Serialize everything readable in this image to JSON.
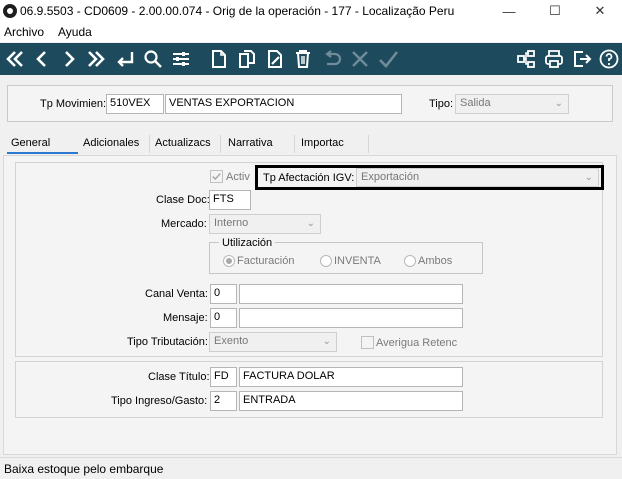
{
  "window": {
    "title": "06.9.5503 - CD0609 - 2.00.00.074 - Orig de la operación - 177 - Localização Peru",
    "minimize": "—",
    "maximize": "☐",
    "close": "✕"
  },
  "menu": {
    "items": [
      "Archivo",
      "Ayuda"
    ]
  },
  "toolbar": {
    "left_icons": [
      "first-icon",
      "previous-icon",
      "next-icon",
      "last-icon",
      "return-icon",
      "search-icon",
      "filter-icon",
      "new-icon",
      "copy-icon",
      "edit-icon",
      "delete-icon",
      "undo-icon",
      "cancel-icon",
      "confirm-icon"
    ],
    "right_icons": [
      "structure-icon",
      "print-icon",
      "exit-icon",
      "help-icon"
    ],
    "color": "#1d4a5c"
  },
  "header": {
    "tp_movimien_label": "Tp Movimien:",
    "tp_movimien_code": "510VEX",
    "tp_movimien_desc": "VENTAS EXPORTACION",
    "tipo_label": "Tipo:",
    "tipo_value": "Salida"
  },
  "tabs": [
    "General",
    "Adicionales",
    "Actualizacs",
    "Narrativa",
    "Importac"
  ],
  "active_tab": "General",
  "general": {
    "activ_label": "Activ",
    "activ_checked": true,
    "tp_afectacion_label": "Tp Afectación IGV:",
    "tp_afectacion_value": "Exportación",
    "clase_doc_label": "Clase Doc:",
    "clase_doc_value": "FTS",
    "mercado_label": "Mercado:",
    "mercado_value": "Interno",
    "utilizacion_label": "Utilización",
    "utilizacion_options": [
      "Facturación",
      "INVENTA",
      "Ambos"
    ],
    "utilizacion_selected": "Facturación",
    "canal_venta_label": "Canal Venta:",
    "canal_venta_value": "0",
    "canal_venta_desc": "",
    "mensaje_label": "Mensaje:",
    "mensaje_value": "0",
    "mensaje_desc": "",
    "tipo_tributacion_label": "Tipo Tributación:",
    "tipo_tributacion_value": "Exento",
    "averigua_label": "Averigua Retenc",
    "averigua_checked": false,
    "clase_titulo_label": "Clase Título:",
    "clase_titulo_code": "FD",
    "clase_titulo_desc": "FACTURA DOLAR",
    "tipo_ingreso_label": "Tipo Ingreso/Gasto:",
    "tipo_ingreso_code": "2",
    "tipo_ingreso_desc": "ENTRADA"
  },
  "status": {
    "text": "Baixa estoque pelo embarque"
  }
}
